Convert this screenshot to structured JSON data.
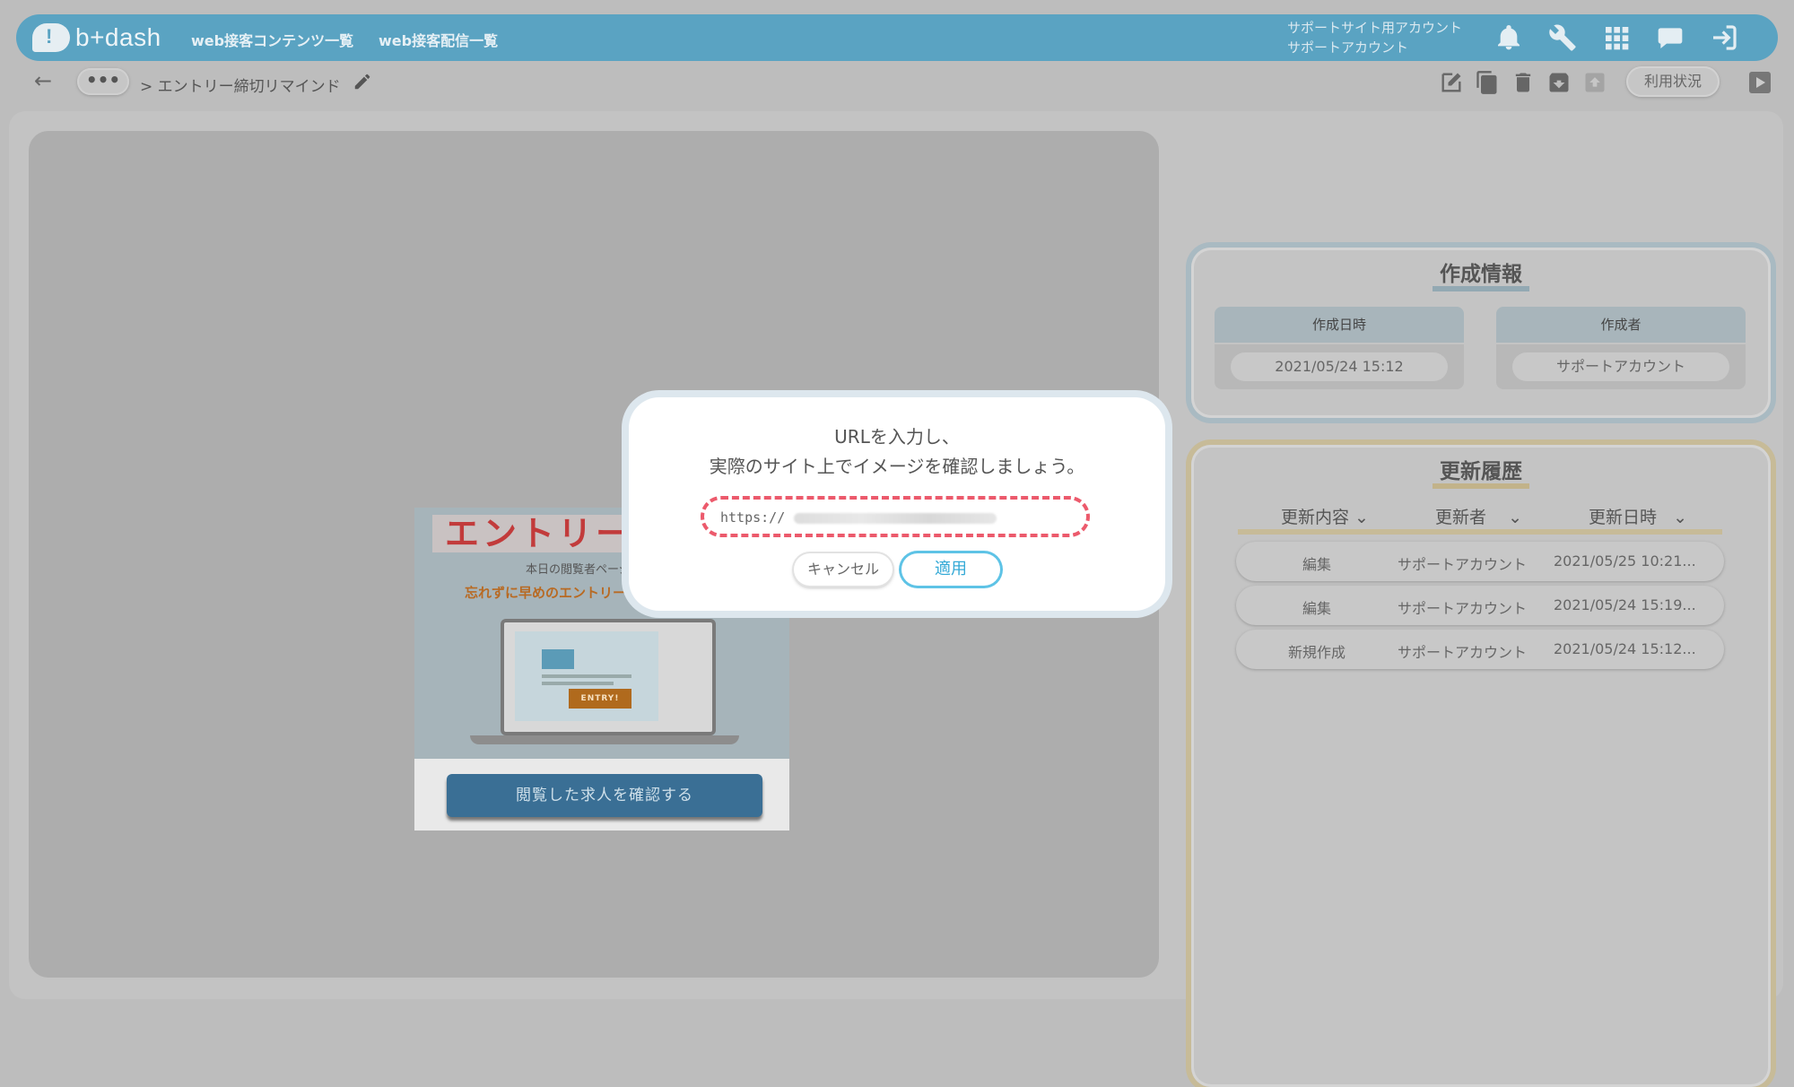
{
  "header": {
    "logo_text": "b+dash",
    "nav": [
      "web接客コンテンツ一覧",
      "web接客配信一覧"
    ],
    "account_line1": "サポートサイト用アカウント",
    "account_line2": "サポートアカウント",
    "icons": [
      "bell-icon",
      "wrench-icon",
      "apps-grid-icon",
      "chat-bubble-icon",
      "logout-icon"
    ],
    "accent_color": "#5aa3c2"
  },
  "subbar": {
    "back_icon": "←",
    "more_label": "•••",
    "breadcrumb": "> エントリー締切リマインド",
    "tools": [
      "edit-icon",
      "copy-icon",
      "trash-icon",
      "archive-icon",
      "export-icon"
    ],
    "usage_label": "利用状況"
  },
  "preview_popup": {
    "title": "エントリー締",
    "subtitle": "本日の閲覧者ページ者",
    "subtitle2": "忘れずに早めのエントリー",
    "entry_label": "ENTRY!",
    "cta_label": "閲覧した求人を確認する",
    "close_label": "✕"
  },
  "info_panel": {
    "title": "作成情報",
    "created_at_label": "作成日時",
    "created_at_value": "2021/05/24 15:12",
    "creator_label": "作成者",
    "creator_value": "サポートアカウント"
  },
  "history_panel": {
    "title": "更新履歴",
    "columns": [
      "更新内容",
      "更新者",
      "更新日時"
    ],
    "rows": [
      {
        "type": "編集",
        "user": "サポートアカウント",
        "date": "2021/05/25 10:21..."
      },
      {
        "type": "編集",
        "user": "サポートアカウント",
        "date": "2021/05/24 15:19..."
      },
      {
        "type": "新規作成",
        "user": "サポートアカウント",
        "date": "2021/05/24 15:12..."
      }
    ]
  },
  "modal": {
    "message_line1": "URLを入力し、",
    "message_line2": "実際のサイト上でイメージを確認しましょう。",
    "url_prefix": "https://",
    "cancel_label": "キャンセル",
    "apply_label": "適用",
    "highlight_color": "#ec5a6c"
  }
}
